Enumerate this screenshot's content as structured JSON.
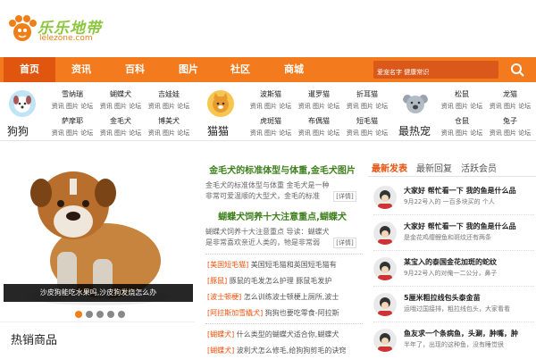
{
  "brand": {
    "name": "乐乐地带",
    "url": "lelezone.com"
  },
  "nav": {
    "items": [
      "首页",
      "资讯",
      "百科",
      "图片",
      "社区",
      "商城"
    ],
    "search_placeholder": "爱宠名字 健康常识"
  },
  "categories": [
    {
      "name": "狗狗",
      "breeds": [
        "雪纳瑞",
        "蝴蝶犬",
        "吉娃娃",
        "萨摩耶",
        "金毛犬",
        "博美犬"
      ]
    },
    {
      "name": "猫猫",
      "breeds": [
        "波斯猫",
        "暹罗猫",
        "折耳猫",
        "虎斑猫",
        "布偶猫",
        "短毛猫"
      ]
    },
    {
      "name": "最热宠",
      "breeds": [
        "松鼠",
        "龙猫",
        "仓鼠",
        "兔子"
      ]
    }
  ],
  "links_text": "资讯 图片 论坛",
  "slider": {
    "caption": "沙皮狗能吃水果吗,沙皮狗发烧怎么办",
    "dot_count": 5,
    "active_dot": 0
  },
  "section_title": "热销商品",
  "news": {
    "headline1": {
      "title": "金毛犬的标准体型与体重,金毛犬图片",
      "summary": "金毛犬的标准体型与体重 金毛犬是一种非常可爱温顺的大型犬，金毛的标准"
    },
    "headline2": {
      "title": "蝴蝶犬饲养十大注意重点,蝴蝶犬",
      "summary": "蝴蝶犬饲养十大注意重点 导读：蝴蝶犬是非常喜欢亲近人类的，牠是非常弱"
    },
    "detail_label": "[详情]",
    "list1": [
      {
        "tag": "[美国短毛猫]",
        "text": "美国短毛猫和英国短毛猫有"
      },
      {
        "tag": "[豚鼠]",
        "text": "豚鼠的毛发怎么护理 豚鼠毛发护"
      },
      {
        "tag": "[波士顿梗]",
        "text": "怎么训练波士顿梗上厕所,波士"
      },
      {
        "tag": "[阿拉斯加雪橇犬]",
        "text": "狗狗也要吃零食-阿拉斯"
      }
    ],
    "list2": [
      {
        "tag": "[蝴蝶犬]",
        "text": "什么类型的蝴蝶犬适合你,蝴蝶犬"
      },
      {
        "tag": "[蝴蝶犬]",
        "text": "波利犬怎么修毛,给狗狗剪毛的诀窍"
      }
    ]
  },
  "right": {
    "tabs": [
      "最新发表",
      "最新回复",
      "活跃会员"
    ],
    "posts": [
      {
        "title": "大家好 帮忙看一下 我的鱼是什么品",
        "desc": "9月22号入的 一百多块买的 个人"
      },
      {
        "title": "大家好 帮忙看一下 我的鱼是什么品",
        "desc": "是金花鸡缨鲤鱼和斑纹还有两条"
      },
      {
        "title": "某宝入的泰国金花加斑的蛇纹",
        "desc": "9月22号入的对俺一二公分，鼻子"
      },
      {
        "title": "5厘米粗拉线包头泰金苗",
        "desc": "运哦过国接排，粗拉线包头，大家看看"
      },
      {
        "title": "鱼友求一个条病鱼，头涮，肿嘴，肿",
        "desc": "半年了，出现的这种鱼，没有睡觉很"
      }
    ]
  },
  "colors": {
    "nav": "#f37b1d",
    "nav_active": "#e0560f",
    "headline": "#3c7f1b",
    "tag": "#e8530f",
    "dot_active": "#f07f17"
  }
}
